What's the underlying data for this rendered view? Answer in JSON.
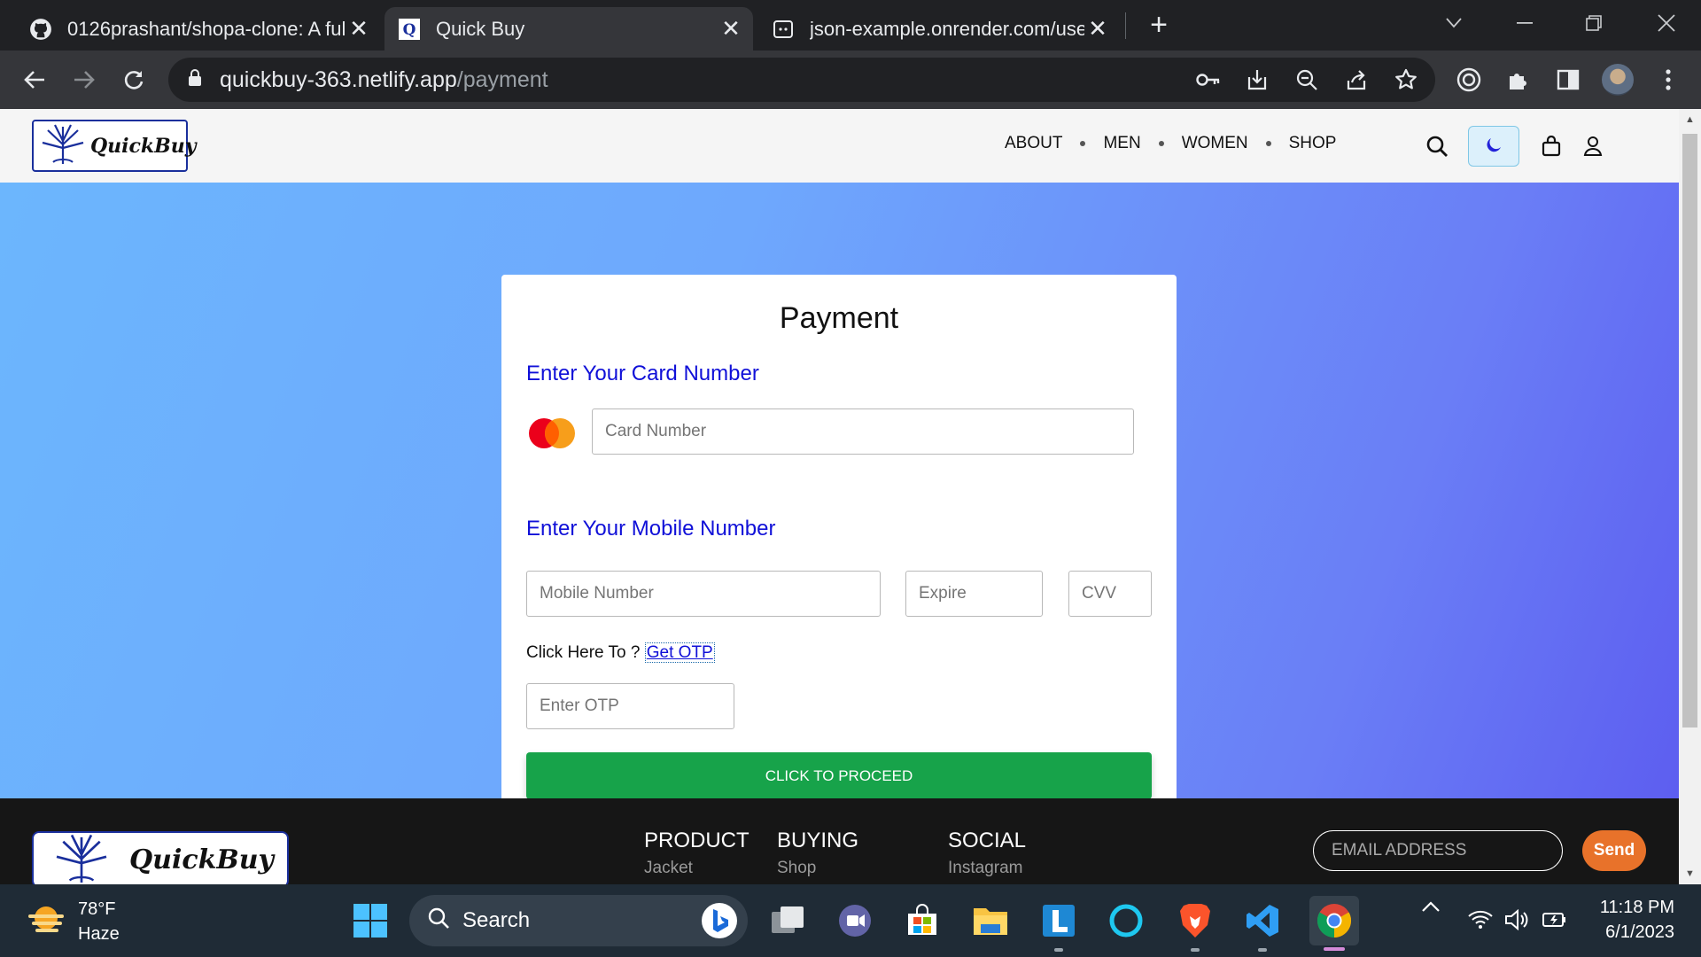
{
  "browser": {
    "tabs": [
      {
        "title": "0126prashant/shopa-clone: A full",
        "close": "✕"
      },
      {
        "title": "Quick Buy",
        "close": "✕"
      },
      {
        "title": "json-example.onrender.com/user",
        "close": "✕"
      }
    ],
    "new_tab": "+",
    "url_host": "quickbuy-363.netlify.app",
    "url_path": "/payment"
  },
  "site": {
    "logo_text": "QuickBuy",
    "nav": [
      "ABOUT",
      "MEN",
      "WOMEN",
      "SHOP"
    ]
  },
  "payment": {
    "title": "Payment",
    "card_label": "Enter Your Card Number",
    "card_placeholder": "Card Number",
    "mobile_label": "Enter Your Mobile Number",
    "mobile_placeholder": "Mobile Number",
    "expire_placeholder": "Expire",
    "cvv_placeholder": "CVV",
    "otp_prompt": "Click Here To ? ",
    "otp_link": "Get OTP",
    "otp_placeholder": "Enter OTP",
    "proceed_label": "CLICK TO PROCEED"
  },
  "footer": {
    "logo_text": "QuickBuy",
    "columns": [
      {
        "heading": "PRODUCT",
        "item": "Jacket"
      },
      {
        "heading": "BUYING",
        "item": "Shop"
      },
      {
        "heading": "SOCIAL",
        "item": "Instagram"
      }
    ],
    "email_placeholder": "EMAIL ADDRESS",
    "send_label": "Send"
  },
  "taskbar": {
    "temperature": "78°F",
    "condition": "Haze",
    "search_label": "Search",
    "time": "11:18 PM",
    "date": "6/1/2023"
  },
  "colors": {
    "accent_blue": "#1010d8",
    "proceed_green": "#17a34a",
    "send_orange": "#e8722a"
  }
}
